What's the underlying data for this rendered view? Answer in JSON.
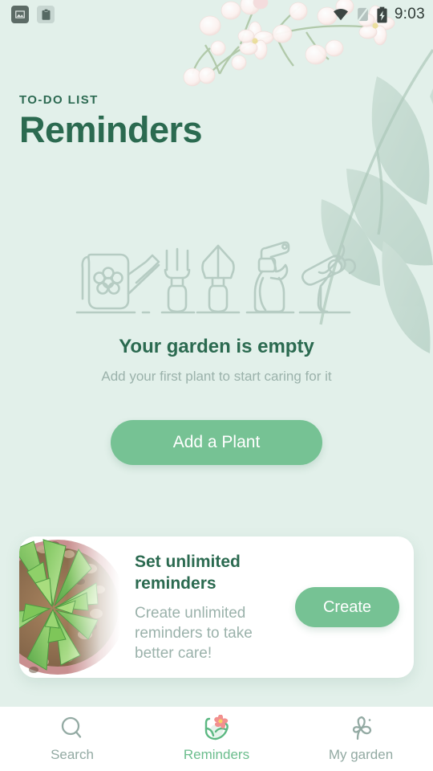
{
  "theme": {
    "background": "#e2f0ea",
    "accent_green": "#76c294",
    "dark_green": "#2b6a50",
    "muted_text": "#9bb2ab",
    "card_background": "#ffffff",
    "nav_active": "#6bbd8d",
    "illustration_stroke": "#b6ccc3"
  },
  "statusbar": {
    "notifications": [
      {
        "icon": "image-icon",
        "name": "image"
      },
      {
        "icon": "clipboard-icon",
        "name": "clipboard"
      }
    ],
    "wifi_icon": "wifi-icon",
    "signal_icon": "no-sim-icon",
    "battery_icon": "battery-charging-icon",
    "time": "9:03"
  },
  "header": {
    "eyebrow": "TO-DO LIST",
    "title": "Reminders"
  },
  "empty_state": {
    "illustration": "garden-tools-illustration",
    "tools": [
      "watering-can",
      "garden-fork",
      "trowel",
      "spray-bottle",
      "pruning-shears"
    ],
    "title": "Your garden is empty",
    "subtitle": "Add your first plant to start caring for it",
    "button_label": "Add a Plant"
  },
  "promo_card": {
    "image": "succulent-plant-photo",
    "title": "Set unlimited reminders",
    "description": "Create unlimited reminders to take better care!",
    "button_label": "Create"
  },
  "bottom_nav": {
    "items": [
      {
        "label": "Search",
        "icon": "search-icon",
        "active": false
      },
      {
        "label": "Reminders",
        "icon": "hands-flower-icon",
        "active": true
      },
      {
        "label": "My garden",
        "icon": "sprout-icon",
        "active": false
      }
    ]
  }
}
